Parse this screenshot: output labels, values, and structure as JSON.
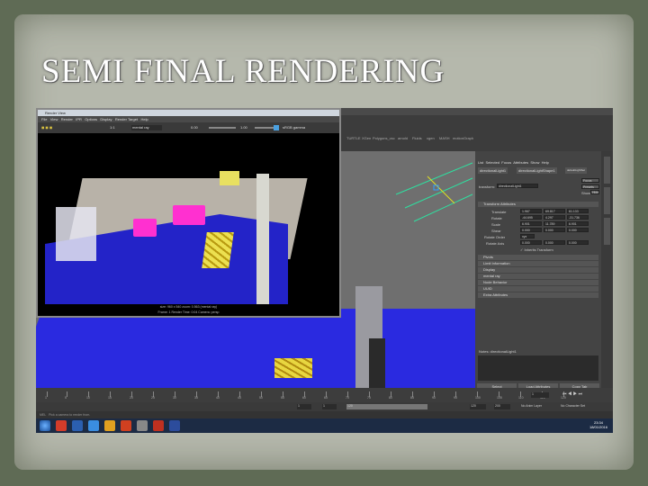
{
  "slide": {
    "title": "SEMI FINAL RENDERING"
  },
  "render_view": {
    "window_title": "Render View",
    "menu": [
      "File",
      "View",
      "Render",
      "IPR",
      "Options",
      "Display",
      "Render Target",
      "Help"
    ],
    "camera": "mental ray",
    "exposure": "0.00",
    "gamma": "1.00",
    "color_profile": "sRGB gamma",
    "zoom": "1:1",
    "status_line1": "size: 960 x 540 zoom: 0.563 (mental ray)",
    "status_line2": "Frame: 1   Render Time: 0:04   Camera: persp"
  },
  "attribute_editor": {
    "menu": [
      "List",
      "Selected",
      "Focus",
      "Attributes",
      "Show",
      "Help"
    ],
    "tabs": [
      "directionalLight1",
      "directionalLightShape1",
      "defaultLightSet"
    ],
    "transform_label": "transform:",
    "transform_value": "directionalLight1",
    "focus_button": "Focus",
    "presets_button": "Presets",
    "show_button": "Show",
    "hide_button": "Hide",
    "section_transform": "Transform Attributes",
    "rows": [
      {
        "label": "Translate",
        "values": [
          "1.967",
          "69.817",
          "61.133"
        ]
      },
      {
        "label": "Rotate",
        "values": [
          "-44.695",
          "4.297",
          "-31.736"
        ]
      },
      {
        "label": "Scale",
        "values": [
          "6.901",
          "11.789",
          "6.901"
        ]
      },
      {
        "label": "Shear",
        "values": [
          "0.000",
          "0.000",
          "0.000"
        ]
      },
      {
        "label": "Rotate Order",
        "values": [
          "xyz"
        ]
      },
      {
        "label": "Rotate Axis",
        "values": [
          "0.000",
          "0.000",
          "0.000"
        ]
      }
    ],
    "inherits": "Inherits Transform",
    "sections": [
      "Pivots",
      "Limit Information",
      "Display",
      "mental ray",
      "Node Behavior",
      "UUID",
      "Extra Attributes"
    ],
    "notes": "Notes:  directionalLight1",
    "select_btn": "Select",
    "load_btn": "Load Attributes",
    "copy_btn": "Copy Tab"
  },
  "viewport": {
    "camera_label": "persp"
  },
  "shelf": [
    "Rendering",
    "Animation",
    "FX",
    "Curves / Surfaces",
    "Polygons",
    "Sculpting",
    "Rigging",
    "nCloth",
    "Polygons_csc",
    "TURTLE",
    "XGen",
    "arnold",
    "Fluids",
    "xgen",
    "MASH",
    "motionGraph"
  ],
  "timeline": {
    "ticks": [
      "1",
      "5",
      "10",
      "15",
      "20",
      "25",
      "30",
      "35",
      "40",
      "45",
      "50",
      "55",
      "60",
      "65",
      "70",
      "75",
      "80",
      "85",
      "90",
      "95",
      "100",
      "105",
      "110",
      "115",
      "120"
    ],
    "current": "1"
  },
  "range": {
    "start": "1",
    "play_start": "1",
    "play_end": "120",
    "end": "120",
    "max": "200",
    "anim_layer": "No Anim Layer",
    "char_set": "No Character Set"
  },
  "mel": {
    "label": "MEL",
    "help": "Pick a camera to render from."
  },
  "taskbar": {
    "time": "23:34",
    "date": "18/01/2016"
  }
}
